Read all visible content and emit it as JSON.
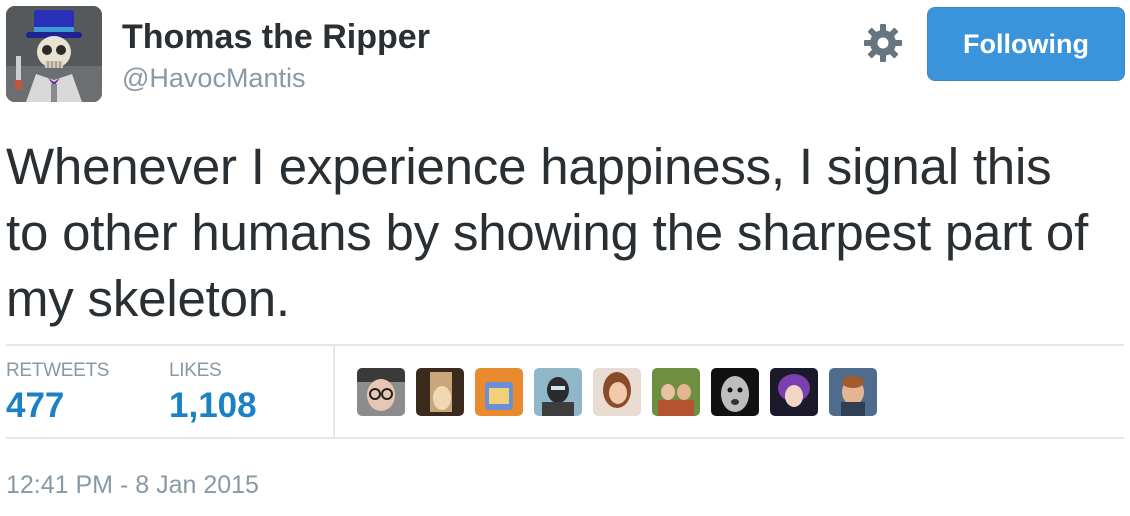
{
  "author": {
    "display_name": "Thomas the Ripper",
    "screen_name": "@HavocMantis",
    "avatar_icon": "skeleton-top-hat-avatar"
  },
  "actions": {
    "settings_icon": "gear-icon",
    "follow_label": "Following",
    "follow_color": "#3b94d9"
  },
  "tweet": {
    "text": "Whenever I experience happiness, I signal this to other humans by showing the sharpest part of my skeleton."
  },
  "stats": {
    "retweets_label": "RETWEETS",
    "retweets_value": "477",
    "likes_label": "LIKES",
    "likes_value": "1,108",
    "value_color": "#1b81c5"
  },
  "likers": [
    {
      "name": "liker-avatar-1"
    },
    {
      "name": "liker-avatar-2"
    },
    {
      "name": "liker-avatar-3"
    },
    {
      "name": "liker-avatar-4"
    },
    {
      "name": "liker-avatar-5"
    },
    {
      "name": "liker-avatar-6"
    },
    {
      "name": "liker-avatar-7"
    },
    {
      "name": "liker-avatar-8"
    },
    {
      "name": "liker-avatar-9"
    }
  ],
  "meta": {
    "timestamp": "12:41 PM - 8 Jan 2015"
  }
}
